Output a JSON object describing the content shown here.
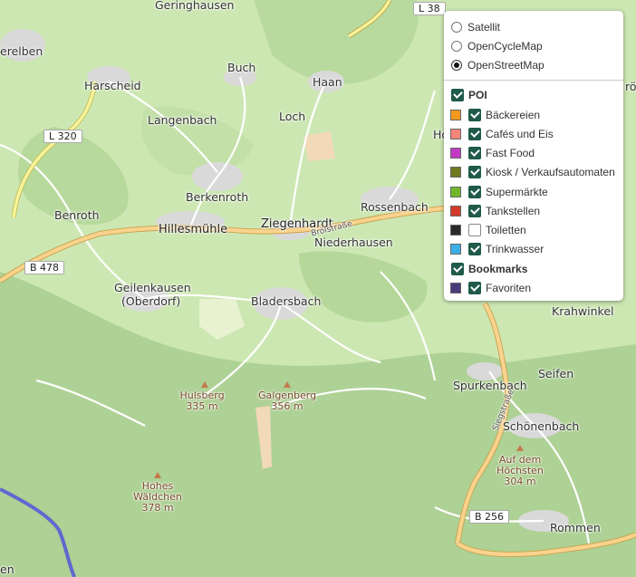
{
  "layers": {
    "base": [
      {
        "label": "Satellit",
        "checked": false
      },
      {
        "label": "OpenCycleMap",
        "checked": false
      },
      {
        "label": "OpenStreetMap",
        "checked": true
      }
    ],
    "poi_group": {
      "label": "POI",
      "checked": true
    },
    "poi": [
      {
        "label": "Bäckereien",
        "checked": true,
        "color": "#f39a1e"
      },
      {
        "label": "Cafés und Eis",
        "checked": true,
        "color": "#f4857a"
      },
      {
        "label": "Fast Food",
        "checked": true,
        "color": "#c23ac4"
      },
      {
        "label": "Kiosk / Verkaufsautomaten",
        "checked": true,
        "color": "#6f7a1f"
      },
      {
        "label": "Supermärkte",
        "checked": true,
        "color": "#70b82a"
      },
      {
        "label": "Tankstellen",
        "checked": true,
        "color": "#d33a2a"
      },
      {
        "label": "Toiletten",
        "checked": false,
        "color": "#2a2a2a"
      },
      {
        "label": "Trinkwasser",
        "checked": true,
        "color": "#3ab0e6"
      }
    ],
    "bookmark_group": {
      "label": "Bookmarks",
      "checked": true
    },
    "bookmarks": [
      {
        "label": "Favoriten",
        "checked": true,
        "color": "#4a3a7a"
      }
    ]
  },
  "places": {
    "geringhausen": "Geringhausen",
    "erelben": "erelben",
    "harscheid": "Harscheid",
    "buch": "Buch",
    "haan": "Haan",
    "langenbach": "Langenbach",
    "loch": "Loch",
    "ho": "Ho",
    "berkenroth": "Berkenroth",
    "benroth": "Benroth",
    "hillesmuehle": "Hillesmühle",
    "ziegenhardt": "Ziegenhardt",
    "rossenbach": "Rossenbach",
    "niederhausen": "Niederhausen",
    "geilenkausen": "Geilenkausen",
    "oberdorf": "(Oberdorf)",
    "bladersbach": "Bladersbach",
    "krahwinkel": "Krahwinkel",
    "seifen": "Seifen",
    "spurkenbach": "Spurkenbach",
    "schoenenbach": "Schönenbach",
    "rommen": "Rommen",
    "en": "en",
    "roe": "rö",
    "broelstrasse": "Bröl­straße",
    "siegstrasse": "Siegstraße"
  },
  "peaks": [
    {
      "name": "Hulsberg",
      "ele": "335 m"
    },
    {
      "name": "Galgenberg",
      "ele": "356 m"
    },
    {
      "name": "Hohes\nWäldchen",
      "ele": "378 m"
    },
    {
      "name": "Auf dem\nHöchsten",
      "ele": "304 m"
    }
  ],
  "roads": {
    "l38": "L 38",
    "l320": "L 320",
    "b478": "B 478",
    "b256": "B 256"
  }
}
